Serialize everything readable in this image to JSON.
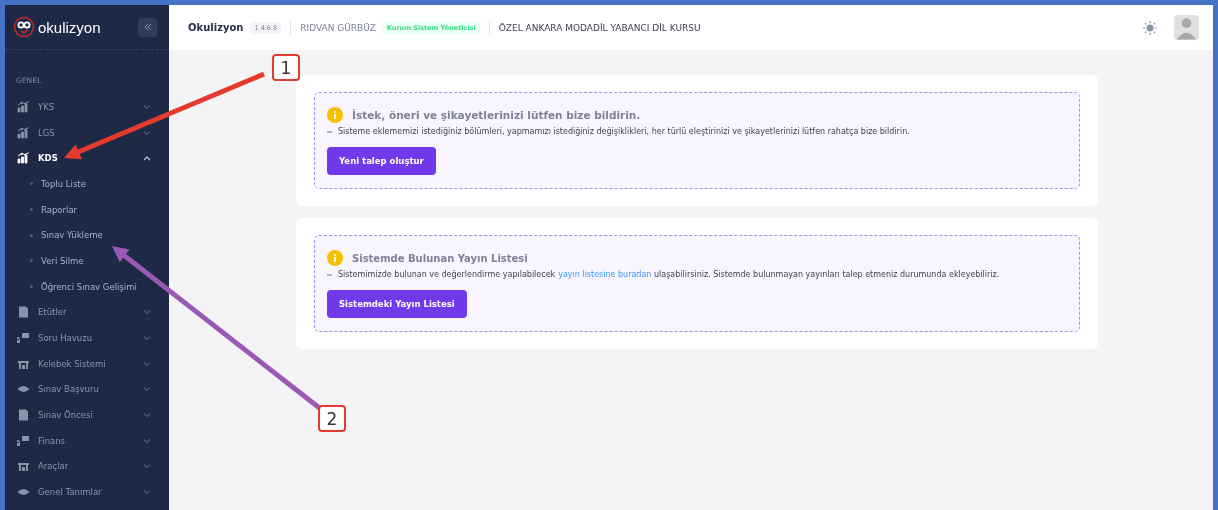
{
  "sidebar": {
    "logo": "okulizyon",
    "section": "GENEL",
    "items": [
      {
        "label": "YKS",
        "expanded": false,
        "selected": false
      },
      {
        "label": "LGS",
        "expanded": false,
        "selected": false
      },
      {
        "label": "KDS",
        "expanded": true,
        "selected": true,
        "children": [
          {
            "label": "Toplu Liste"
          },
          {
            "label": "Raporlar"
          },
          {
            "label": "Sınav Yükleme"
          },
          {
            "label": "Veri Silme"
          },
          {
            "label": "Öğrenci Sınav Gelişimi"
          }
        ]
      },
      {
        "label": "Etütler",
        "expanded": false,
        "selected": false
      },
      {
        "label": "Soru Havuzu",
        "expanded": false,
        "selected": false
      },
      {
        "label": "Kelebek Sistemi",
        "expanded": false,
        "selected": false
      },
      {
        "label": "Sınav Başvuru",
        "expanded": false,
        "selected": false
      },
      {
        "label": "Sınav Öncesi",
        "expanded": false,
        "selected": false
      },
      {
        "label": "Finans",
        "expanded": false,
        "selected": false
      },
      {
        "label": "Araçlar",
        "expanded": false,
        "selected": false
      },
      {
        "label": "Genel Tanımlar",
        "expanded": false,
        "selected": false
      }
    ]
  },
  "header": {
    "app": "Okulizyon",
    "version": "1.4.6.8",
    "user": "RIDVAN GÜRBÜZ",
    "role": "Kurum Sistem Yöneticisi",
    "institution": "ÖZEL ANKARA MODADİL YABANCI DİL KURSU"
  },
  "cards": [
    {
      "title": "İstek, öneri ve şikayetlerinizi lütfen bize bildirin.",
      "text_before": "Sisteme eklememizi istediğiniz bölümleri, yapmamızı istediğiniz değişiklikleri, her türlü eleştirinizi ve şikayetlerinizi lütfen rahatça bize bildirin.",
      "button": "Yeni talep oluştur"
    },
    {
      "title": "Sistemde Bulunan Yayın Listesi",
      "text_before": "Sistemimizde bulunan ve değerlendirme yapılabilecek",
      "link": "yayın listesine buradan",
      "text_after": "ulaşabilirsiniz. Sistemde bulunmayan yayınları talep etmeniz durumunda ekleyebiliriz.",
      "button": "Sistemdeki Yayın Listesi"
    }
  ],
  "callouts": [
    {
      "label": "1"
    },
    {
      "label": "2"
    }
  ]
}
